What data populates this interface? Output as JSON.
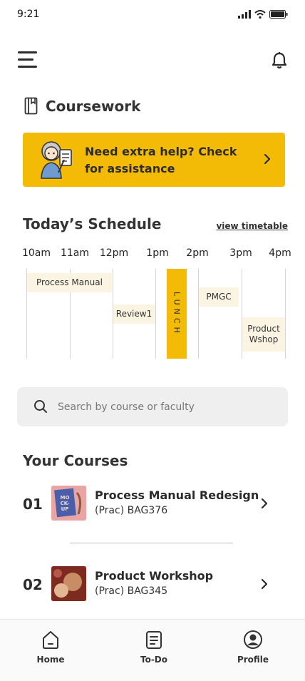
{
  "status_bar": {
    "time": "9:21"
  },
  "section": {
    "title": "Coursework"
  },
  "help_banner": {
    "text": "Need extra help? Check for assistance"
  },
  "schedule": {
    "title": "Today’s Schedule",
    "view_link": "view timetable",
    "times": [
      "10am",
      "11am",
      "12pm",
      "1pm",
      "2pm",
      "3pm",
      "4pm"
    ],
    "events": [
      {
        "label": "Process Manual"
      },
      {
        "label": "Review1"
      },
      {
        "label": "PMGC"
      },
      {
        "label": "Product Wshop"
      }
    ],
    "lunch_label": "LUNCH"
  },
  "search": {
    "placeholder": "Search by course or faculty"
  },
  "courses": {
    "title": "Your Courses",
    "items": [
      {
        "number": "01",
        "name": "Process Manual Redesign",
        "code": "(Prac) BAG376",
        "thumb_text": "MO CK- UP"
      },
      {
        "number": "02",
        "name": "Product Workshop",
        "code": "(Prac) BAG345"
      }
    ]
  },
  "tabbar": {
    "items": [
      {
        "label": "Home",
        "icon": "home-icon"
      },
      {
        "label": "To-Do",
        "icon": "todo-icon"
      },
      {
        "label": "Profile",
        "icon": "profile-icon"
      }
    ]
  },
  "colors": {
    "accent": "#f4bb06",
    "event_bg": "#fbf4e3",
    "search_bg": "#efefef"
  }
}
